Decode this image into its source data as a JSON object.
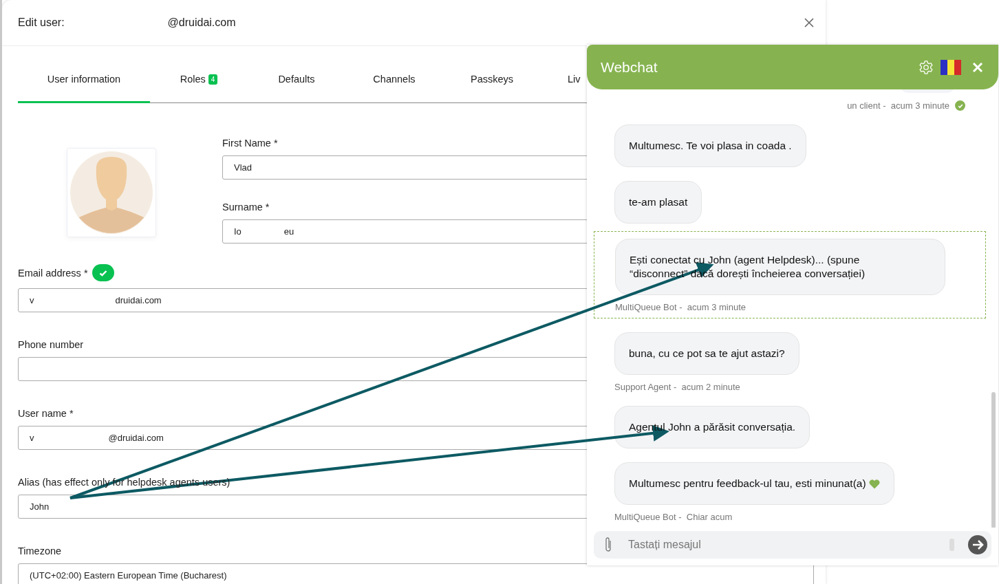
{
  "dialog": {
    "title_prefix": "Edit user:",
    "title_suffix": "@druidai.com"
  },
  "tabs": [
    {
      "label": "User information",
      "selected": true
    },
    {
      "label": "Roles",
      "badge": "4",
      "selected": false
    },
    {
      "label": "Defaults",
      "selected": false
    },
    {
      "label": "Channels",
      "selected": false
    },
    {
      "label": "Passkeys",
      "selected": false
    },
    {
      "label": "Liv",
      "selected": false
    }
  ],
  "form": {
    "first_name": {
      "label": "First Name *",
      "value": "Vlad"
    },
    "surname": {
      "label": "Surname *",
      "value_start": "Io",
      "value_end": "eu"
    },
    "email": {
      "label": "Email address *",
      "verified": true,
      "value_start": "v",
      "value_end": "druidai.com"
    },
    "phone": {
      "label": "Phone number"
    },
    "user_name": {
      "label": "User name *",
      "value_start": "v",
      "value_end": "@druidai.com"
    },
    "alias": {
      "label": "Alias (has effect only for helpdesk agents users)",
      "value": "John"
    },
    "timezone": {
      "label": "Timezone",
      "value": "(UTC+02:00) Eastern European Time (Bucharest)"
    }
  },
  "webchat": {
    "title": "Webchat",
    "messages": [
      {
        "kind": "meta",
        "sender": "un client -",
        "time": "acum 3 minute",
        "delivered": true
      },
      {
        "kind": "bubble",
        "text": "Multumesc. Te voi plasa in coada .",
        "highlighted": false
      },
      {
        "kind": "bubble",
        "text": "te-am plasat",
        "highlighted": false
      },
      {
        "kind": "bubble",
        "text": "Ești conectat cu John (agent Helpdesk)... (spune “disconnect” dacă dorești încheierea conversației)",
        "sender": "MultiQueue Bot -",
        "time": "acum 3 minute",
        "highlighted": true
      },
      {
        "kind": "bubble",
        "text": "buna, cu ce pot sa te ajut astazi?",
        "sender": "Support Agent -",
        "time": "acum 2 minute",
        "highlighted": false
      },
      {
        "kind": "bubble",
        "text": "Agentul John a părăsit conversația.",
        "highlighted": false
      },
      {
        "kind": "bubble",
        "text": "Multumesc pentru feedback-ul tau, esti minunat(a)",
        "heart": true,
        "sender": "MultiQueue Bot -",
        "time": "Chiar acum",
        "highlighted": false
      }
    ],
    "input": {
      "placeholder": "Tastați mesajul"
    }
  }
}
